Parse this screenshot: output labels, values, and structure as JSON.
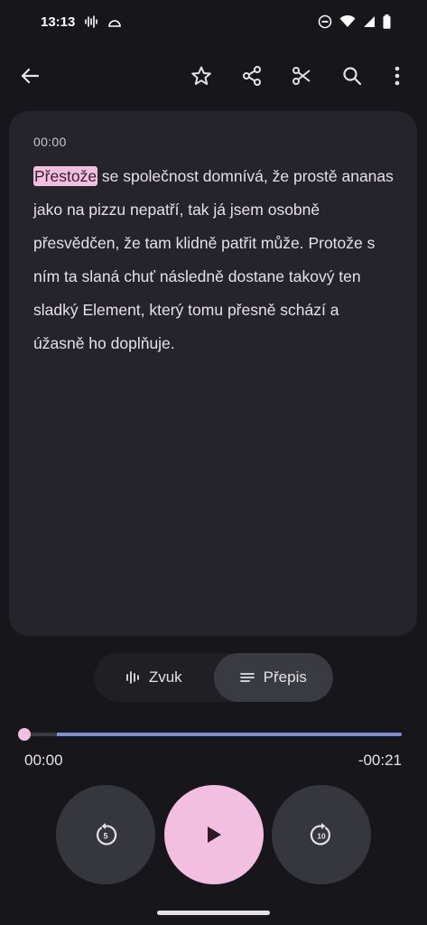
{
  "status_bar": {
    "time": "13:13",
    "icons": [
      "sound-wave-icon",
      "cast-icon",
      "dnd-icon",
      "wifi-icon",
      "signal-icon",
      "battery-icon"
    ]
  },
  "toolbar": {
    "icons": [
      "back-arrow-icon",
      "star-icon",
      "share-icon",
      "scissors-icon",
      "search-icon",
      "more-vert-icon"
    ]
  },
  "transcript": {
    "timestamp": "00:00",
    "highlighted_word": "Přestože",
    "text_rest": " se společnost domnívá, že prostě ananas jako na pizzu nepatří, tak já jsem osobně přesvědčen, že tam klidně patřit může. Protože s ním ta slaná chuť následně dostane takový ten sladký Element, který tomu přesně schází a úžasně ho doplňuje."
  },
  "view_toggle": {
    "audio_label": "Zvuk",
    "transcript_label": "Přepis",
    "selected": "transcript"
  },
  "player": {
    "current_time": "00:00",
    "remaining_time": "-00:21",
    "progress": 0.0,
    "rewind_label": "5",
    "forward_label": "10"
  },
  "colors": {
    "background": "#17171b",
    "card": "#24242a",
    "accent_pink": "#f2bfe0",
    "accent_blue": "#7e8fd3"
  }
}
